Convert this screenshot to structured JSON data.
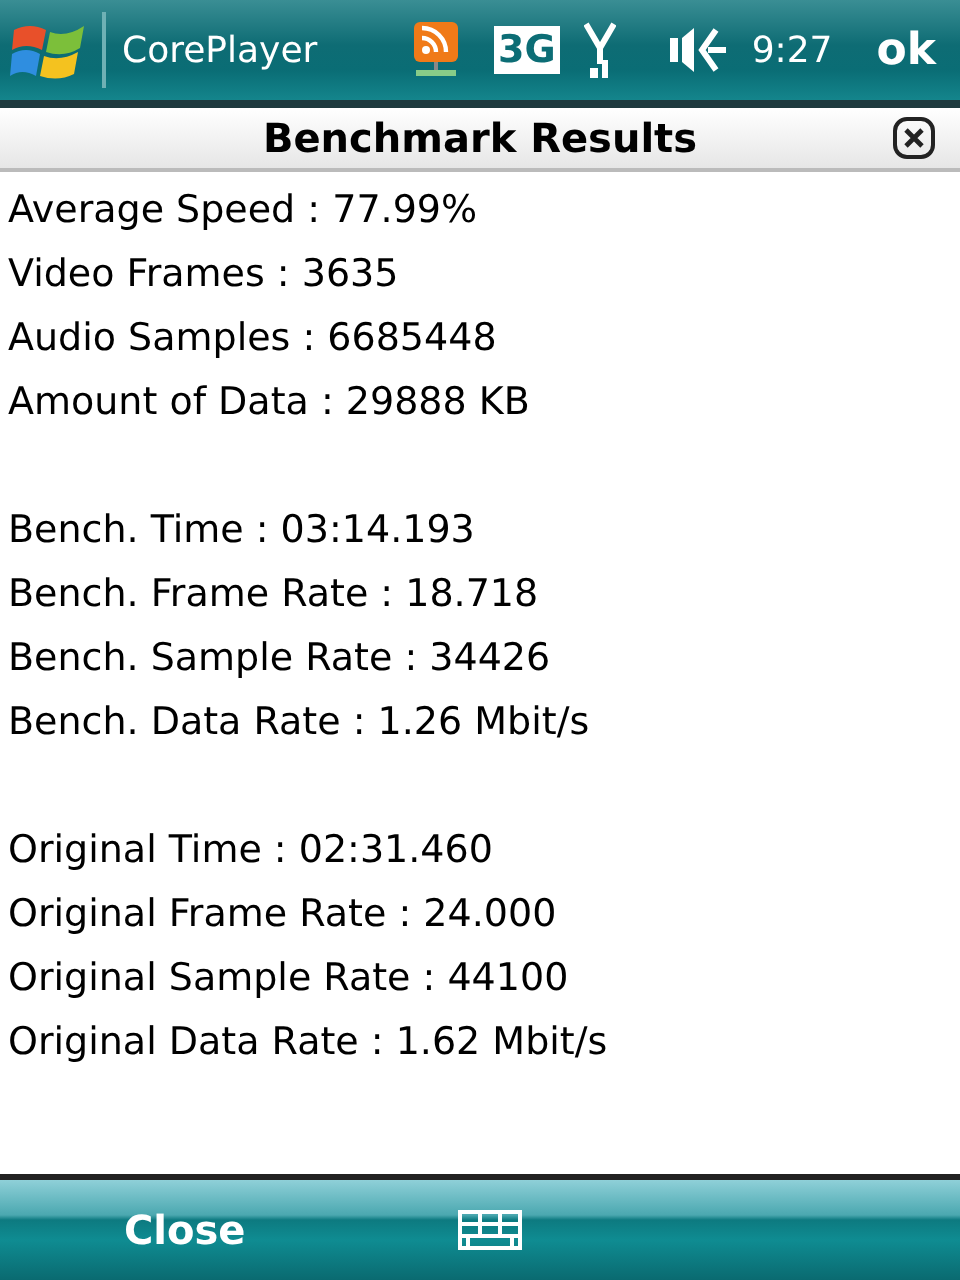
{
  "status_bar": {
    "app_title": "CorePlayer",
    "network": "3G",
    "time": "9:27",
    "ok": "ok"
  },
  "dialog": {
    "title": "Benchmark Results"
  },
  "groups": [
    [
      "Average Speed : 77.99%",
      "Video Frames : 3635",
      "Audio Samples : 6685448",
      "Amount of Data : 29888 KB"
    ],
    [
      "Bench. Time : 03:14.193",
      "Bench. Frame Rate : 18.718",
      "Bench. Sample Rate : 34426",
      "Bench. Data Rate : 1.26 Mbit/s"
    ],
    [
      "Original Time : 02:31.460",
      "Original Frame Rate : 24.000",
      "Original Sample Rate : 44100",
      "Original Data Rate : 1.62 Mbit/s"
    ]
  ],
  "soft_keys": {
    "left": "Close"
  }
}
